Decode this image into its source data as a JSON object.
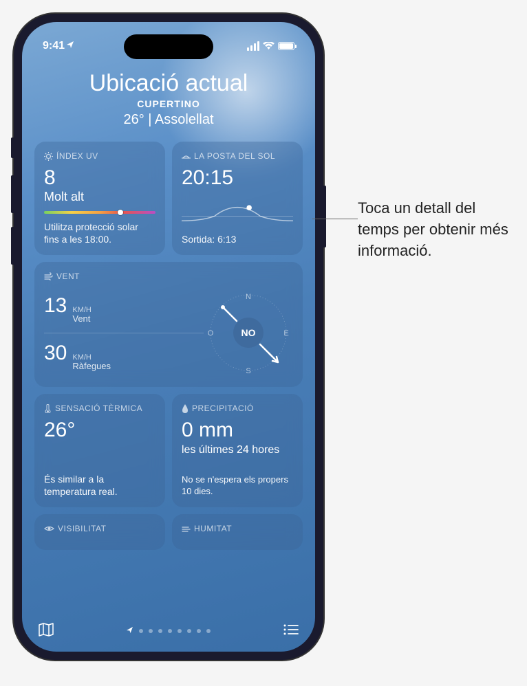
{
  "status": {
    "time": "9:41",
    "location_icon": "location-arrow"
  },
  "header": {
    "title": "Ubicació actual",
    "city": "CUPERTINO",
    "temp_condition": "26° | Assolellat"
  },
  "tiles": {
    "uv": {
      "label": "ÍNDEX UV",
      "value": "8",
      "level": "Molt alt",
      "desc": "Utilitza protecció solar fins a les 18:00."
    },
    "sunset": {
      "label": "LA POSTA DEL SOL",
      "value": "20:15",
      "sunrise": "Sortida: 6:13"
    },
    "wind": {
      "label": "VENT",
      "speed": "13",
      "speed_unit": "KM/H",
      "speed_label": "Vent",
      "gust": "30",
      "gust_unit": "KM/H",
      "gust_label": "Ràfegues",
      "direction": "NO",
      "compass_n": "N",
      "compass_s": "S",
      "compass_e": "E",
      "compass_o": "O"
    },
    "feels": {
      "label": "SENSACIÓ TÈRMICA",
      "value": "26°",
      "desc": "És similar a la temperatura real."
    },
    "precip": {
      "label": "PRECIPITACIÓ",
      "value": "0 mm",
      "sub": "les últimes 24 hores",
      "desc": "No se n'espera els propers 10 dies."
    },
    "visibility": {
      "label": "VISIBILITAT"
    },
    "humidity": {
      "label": "HUMITAT"
    }
  },
  "annotation": "Toca un detall del temps per obtenir més informació."
}
